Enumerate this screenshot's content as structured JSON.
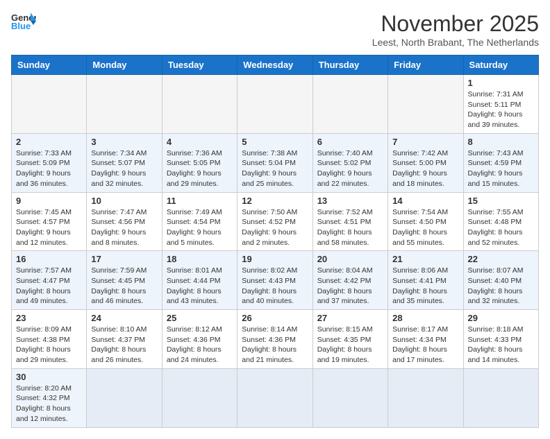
{
  "header": {
    "logo_general": "General",
    "logo_blue": "Blue",
    "month_title": "November 2025",
    "subtitle": "Leest, North Brabant, The Netherlands"
  },
  "calendar": {
    "days_of_week": [
      "Sunday",
      "Monday",
      "Tuesday",
      "Wednesday",
      "Thursday",
      "Friday",
      "Saturday"
    ],
    "weeks": [
      [
        {
          "day": "",
          "info": ""
        },
        {
          "day": "",
          "info": ""
        },
        {
          "day": "",
          "info": ""
        },
        {
          "day": "",
          "info": ""
        },
        {
          "day": "",
          "info": ""
        },
        {
          "day": "",
          "info": ""
        },
        {
          "day": "1",
          "info": "Sunrise: 7:31 AM\nSunset: 5:11 PM\nDaylight: 9 hours\nand 39 minutes."
        }
      ],
      [
        {
          "day": "2",
          "info": "Sunrise: 7:33 AM\nSunset: 5:09 PM\nDaylight: 9 hours\nand 36 minutes."
        },
        {
          "day": "3",
          "info": "Sunrise: 7:34 AM\nSunset: 5:07 PM\nDaylight: 9 hours\nand 32 minutes."
        },
        {
          "day": "4",
          "info": "Sunrise: 7:36 AM\nSunset: 5:05 PM\nDaylight: 9 hours\nand 29 minutes."
        },
        {
          "day": "5",
          "info": "Sunrise: 7:38 AM\nSunset: 5:04 PM\nDaylight: 9 hours\nand 25 minutes."
        },
        {
          "day": "6",
          "info": "Sunrise: 7:40 AM\nSunset: 5:02 PM\nDaylight: 9 hours\nand 22 minutes."
        },
        {
          "day": "7",
          "info": "Sunrise: 7:42 AM\nSunset: 5:00 PM\nDaylight: 9 hours\nand 18 minutes."
        },
        {
          "day": "8",
          "info": "Sunrise: 7:43 AM\nSunset: 4:59 PM\nDaylight: 9 hours\nand 15 minutes."
        }
      ],
      [
        {
          "day": "9",
          "info": "Sunrise: 7:45 AM\nSunset: 4:57 PM\nDaylight: 9 hours\nand 12 minutes."
        },
        {
          "day": "10",
          "info": "Sunrise: 7:47 AM\nSunset: 4:56 PM\nDaylight: 9 hours\nand 8 minutes."
        },
        {
          "day": "11",
          "info": "Sunrise: 7:49 AM\nSunset: 4:54 PM\nDaylight: 9 hours\nand 5 minutes."
        },
        {
          "day": "12",
          "info": "Sunrise: 7:50 AM\nSunset: 4:52 PM\nDaylight: 9 hours\nand 2 minutes."
        },
        {
          "day": "13",
          "info": "Sunrise: 7:52 AM\nSunset: 4:51 PM\nDaylight: 8 hours\nand 58 minutes."
        },
        {
          "day": "14",
          "info": "Sunrise: 7:54 AM\nSunset: 4:50 PM\nDaylight: 8 hours\nand 55 minutes."
        },
        {
          "day": "15",
          "info": "Sunrise: 7:55 AM\nSunset: 4:48 PM\nDaylight: 8 hours\nand 52 minutes."
        }
      ],
      [
        {
          "day": "16",
          "info": "Sunrise: 7:57 AM\nSunset: 4:47 PM\nDaylight: 8 hours\nand 49 minutes."
        },
        {
          "day": "17",
          "info": "Sunrise: 7:59 AM\nSunset: 4:45 PM\nDaylight: 8 hours\nand 46 minutes."
        },
        {
          "day": "18",
          "info": "Sunrise: 8:01 AM\nSunset: 4:44 PM\nDaylight: 8 hours\nand 43 minutes."
        },
        {
          "day": "19",
          "info": "Sunrise: 8:02 AM\nSunset: 4:43 PM\nDaylight: 8 hours\nand 40 minutes."
        },
        {
          "day": "20",
          "info": "Sunrise: 8:04 AM\nSunset: 4:42 PM\nDaylight: 8 hours\nand 37 minutes."
        },
        {
          "day": "21",
          "info": "Sunrise: 8:06 AM\nSunset: 4:41 PM\nDaylight: 8 hours\nand 35 minutes."
        },
        {
          "day": "22",
          "info": "Sunrise: 8:07 AM\nSunset: 4:40 PM\nDaylight: 8 hours\nand 32 minutes."
        }
      ],
      [
        {
          "day": "23",
          "info": "Sunrise: 8:09 AM\nSunset: 4:38 PM\nDaylight: 8 hours\nand 29 minutes."
        },
        {
          "day": "24",
          "info": "Sunrise: 8:10 AM\nSunset: 4:37 PM\nDaylight: 8 hours\nand 26 minutes."
        },
        {
          "day": "25",
          "info": "Sunrise: 8:12 AM\nSunset: 4:36 PM\nDaylight: 8 hours\nand 24 minutes."
        },
        {
          "day": "26",
          "info": "Sunrise: 8:14 AM\nSunset: 4:36 PM\nDaylight: 8 hours\nand 21 minutes."
        },
        {
          "day": "27",
          "info": "Sunrise: 8:15 AM\nSunset: 4:35 PM\nDaylight: 8 hours\nand 19 minutes."
        },
        {
          "day": "28",
          "info": "Sunrise: 8:17 AM\nSunset: 4:34 PM\nDaylight: 8 hours\nand 17 minutes."
        },
        {
          "day": "29",
          "info": "Sunrise: 8:18 AM\nSunset: 4:33 PM\nDaylight: 8 hours\nand 14 minutes."
        }
      ],
      [
        {
          "day": "30",
          "info": "Sunrise: 8:20 AM\nSunset: 4:32 PM\nDaylight: 8 hours\nand 12 minutes."
        },
        {
          "day": "",
          "info": ""
        },
        {
          "day": "",
          "info": ""
        },
        {
          "day": "",
          "info": ""
        },
        {
          "day": "",
          "info": ""
        },
        {
          "day": "",
          "info": ""
        },
        {
          "day": "",
          "info": ""
        }
      ]
    ]
  }
}
